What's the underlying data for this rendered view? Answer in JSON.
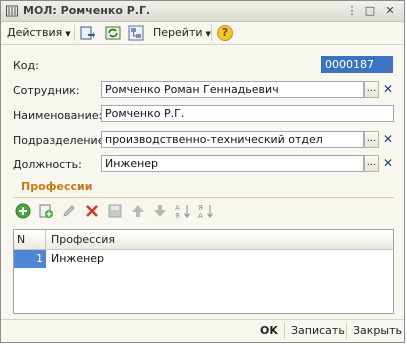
{
  "window": {
    "title": "МОЛ: Ромченко Р.Г.",
    "title_icon": "catalog-icon",
    "controls": [
      "⋮",
      "□",
      "✕"
    ]
  },
  "toolbar": {
    "actions_label": "Действия",
    "goto_label": "Перейти",
    "help_label": "?"
  },
  "form": {
    "code": {
      "label": "Код:",
      "value": "0000187"
    },
    "employee": {
      "label": "Сотрудник:",
      "value": "Ромченко Роман Геннадьевич"
    },
    "name": {
      "label": "Наименование:",
      "value": "Ромченко Р.Г."
    },
    "department": {
      "label": "Подразделение:",
      "value": "производственно-технический отдел"
    },
    "position": {
      "label": "Должность:",
      "value": "Инженер"
    },
    "select_label": "...",
    "clear_label": "✕"
  },
  "professions": {
    "title": "Профессии",
    "columns": {
      "n": "N",
      "profession": "Профессия"
    },
    "rows": [
      {
        "n": "1",
        "profession": "Инженер"
      }
    ]
  },
  "footer": {
    "ok_label": "OK",
    "save_label": "Записать",
    "close_label": "Закрыть"
  },
  "colors": {
    "accent_section": "#c87a10",
    "selection": "#3b73c2",
    "clear_x": "#1f3d7a"
  }
}
